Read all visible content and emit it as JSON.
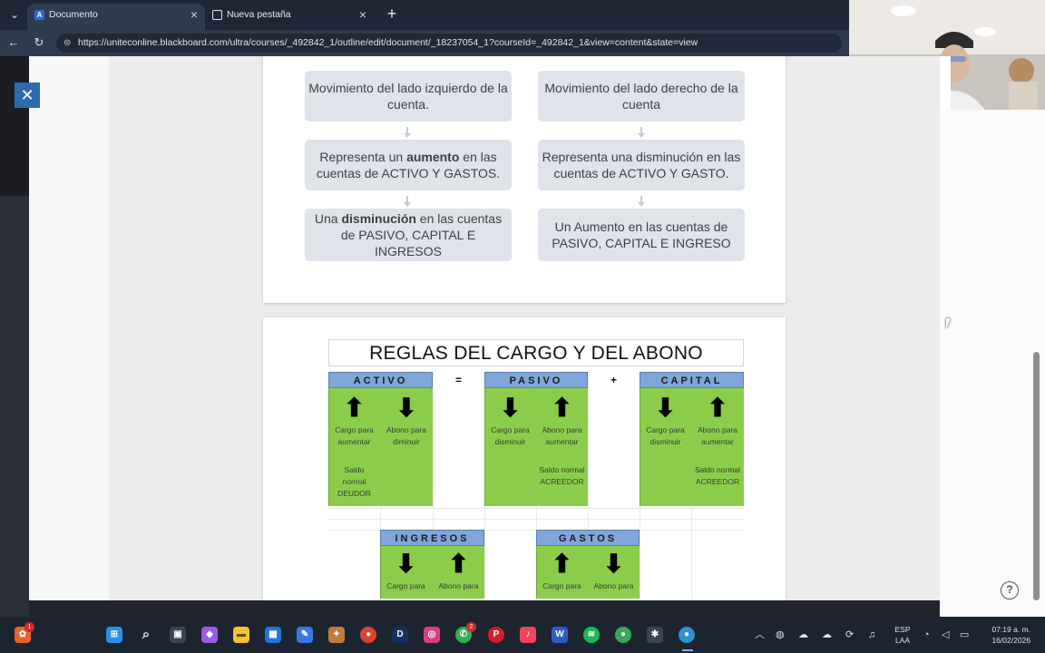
{
  "browser": {
    "tabs": [
      {
        "title": "Documento",
        "favicon": "A",
        "active": true
      },
      {
        "title": "Nueva pestaña",
        "favicon": "▭",
        "active": false
      }
    ],
    "url": "https://uniteconline.blackboard.com/ultra/courses/_492842_1/outline/edit/document/_18237054_1?courseId=_492842_1&view=content&state=view"
  },
  "diagram": {
    "left": {
      "node1": "Movimiento del lado izquierdo de la cuenta.",
      "node2_pre": "Representa un ",
      "node2_bold": "aumento",
      "node2_post": " en las cuentas de ACTIVO Y GASTOS.",
      "node3_pre": "Una ",
      "node3_bold": "disminución",
      "node3_post": " en las cuentas de PASIVO, CAPITAL E INGRESOS"
    },
    "right": {
      "node1": "Movimiento del  lado derecho de la cuenta",
      "node2": "Representa una disminución en las cuentas de ACTIVO Y GASTO.",
      "node3": "Un Aumento en las cuentas de PASIVO, CAPITAL E INGRESO"
    }
  },
  "rules": {
    "title": "REGLAS DEL CARGO Y DEL ABONO",
    "headers": {
      "activo": "ACTIVO",
      "eq": "=",
      "pasivo": "PASIVO",
      "plus": "+",
      "capital": "CAPITAL",
      "ingresos": "INGRESOS",
      "gastos": "GASTOS"
    },
    "cols": [
      {
        "arrow": "⬆",
        "label": "Cargo para aumentar",
        "saldo": "Saldo normal DEUDOR"
      },
      {
        "arrow": "⬇",
        "label": "Abono para diminuir",
        "saldo": ""
      },
      {
        "arrow": "⬇",
        "label": "Cargo para disminuir",
        "saldo": ""
      },
      {
        "arrow": "⬆",
        "label": "Abono para aumentar",
        "saldo": "Saldo normal ACREEDOR"
      },
      {
        "arrow": "⬇",
        "label": "Cargo para disminuir",
        "saldo": ""
      },
      {
        "arrow": "⬆",
        "label": "Abono para aumentar",
        "saldo": "Saldo normal ACREEDOR"
      }
    ],
    "bottom": [
      {
        "arrow": "⬇",
        "label": "Cargo para"
      },
      {
        "arrow": "⬆",
        "label": "Abono para"
      },
      {
        "arrow": "⬆",
        "label": "Cargo para"
      },
      {
        "arrow": "⬇",
        "label": "Abono para"
      }
    ]
  },
  "taskbar": {
    "lang1": "ESP",
    "lang2": "LAA",
    "time": "07:19 a. m.",
    "date": "16/02/2026",
    "badge1": "1",
    "badge2": "2"
  },
  "colors": {
    "header_blue": "#7fa6d8",
    "green": "#8bcd4a",
    "tab_bg": "#1e2736",
    "close_blue": "#2d6bb0"
  }
}
